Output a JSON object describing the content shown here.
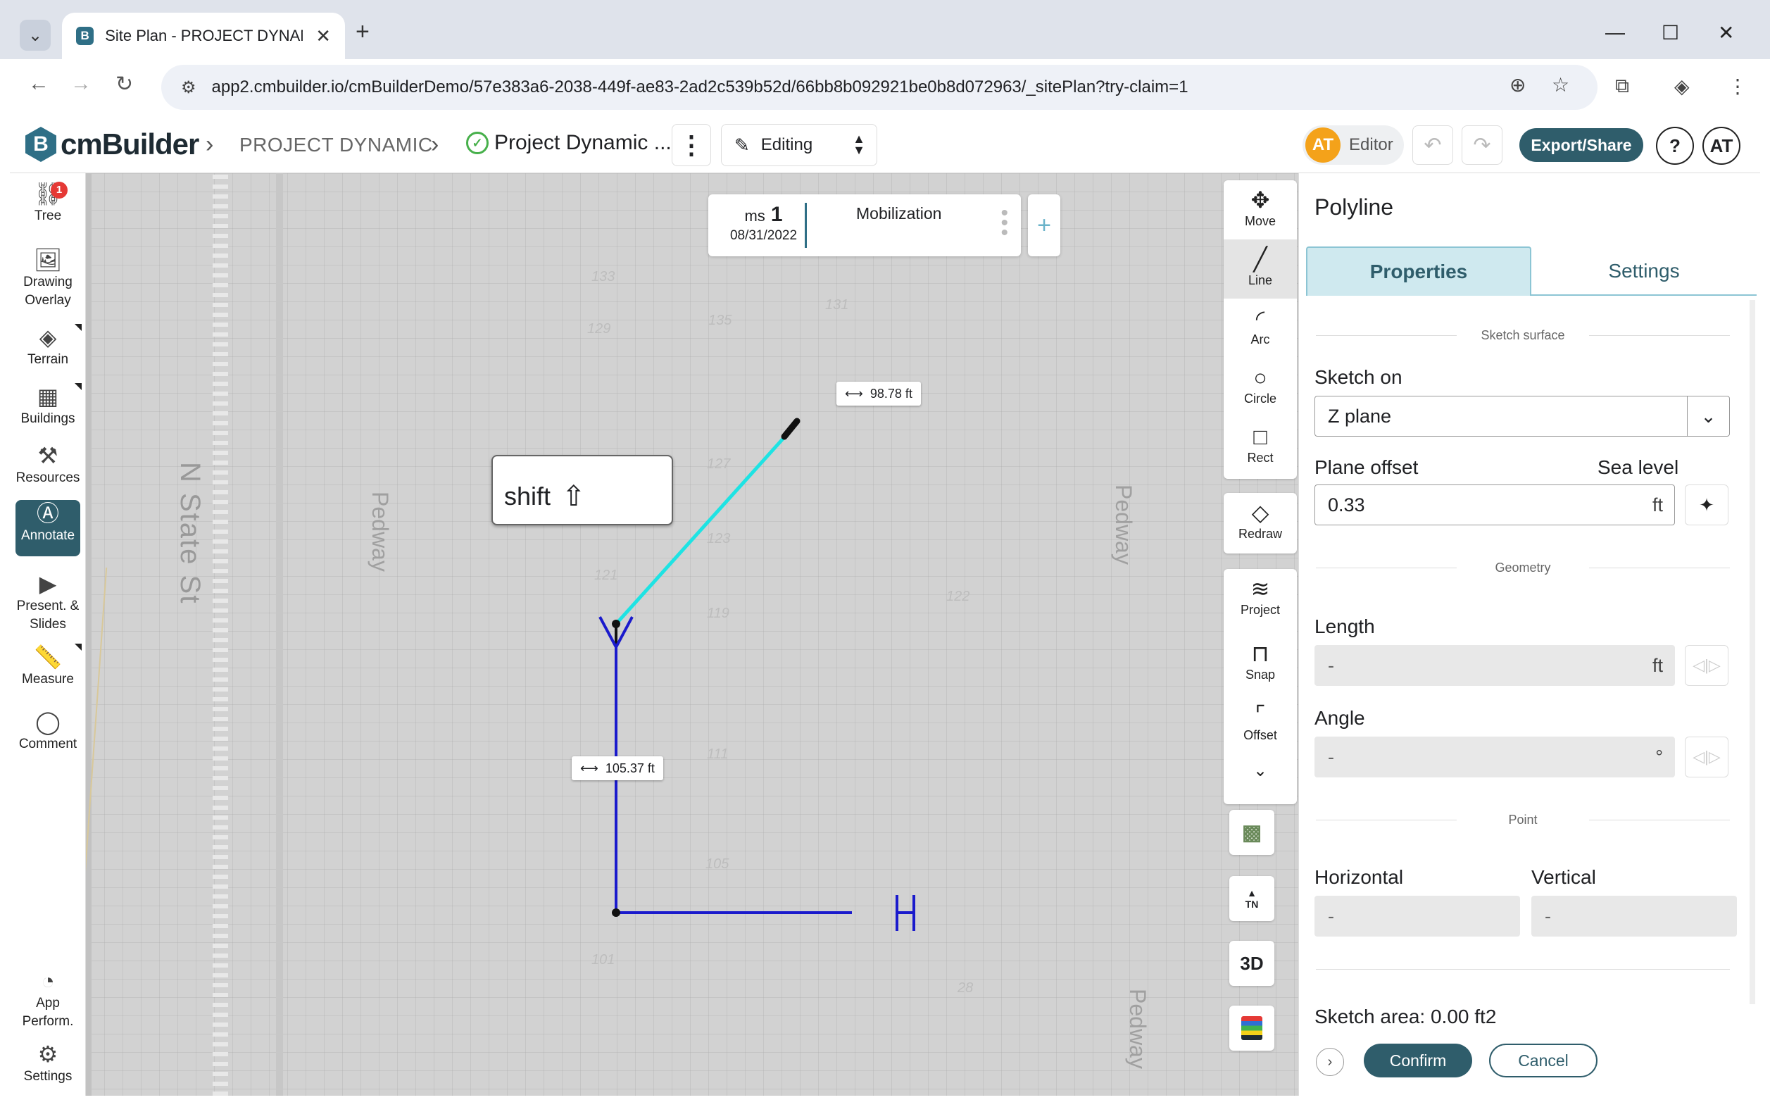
{
  "browser": {
    "tab_title": "Site Plan - PROJECT DYNAMIC |",
    "tab_favicon": "B",
    "url": "app2.cmbuilder.io/cmBuilderDemo/57e383a6-2038-449f-ae83-2ad2c539b52d/66bb8b092921be0b8d072963/_sitePlan?try-claim=1",
    "new_tab": "+",
    "tab_close": "✕"
  },
  "header": {
    "logo_mark": "B",
    "logo_text": "cmBuilder",
    "breadcrumb_project": "PROJECT DYNAMIC",
    "breadcrumb_plan": "Project Dynamic ...",
    "mode_label": "Editing",
    "editor_initials": "AT",
    "editor_label": "Editor",
    "export_label": "Export/Share",
    "help_label": "?",
    "user_initials": "AT"
  },
  "sidebar": {
    "items": [
      {
        "label": "Tree",
        "icon": "tree-icon",
        "badge": "1"
      },
      {
        "label": "Drawing Overlay",
        "icon": "image-icon"
      },
      {
        "label": "Terrain",
        "icon": "terrain-icon"
      },
      {
        "label": "Buildings",
        "icon": "buildings-icon"
      },
      {
        "label": "Resources",
        "icon": "resources-icon"
      },
      {
        "label": "Annotate",
        "icon": "annotate-icon",
        "active": true
      },
      {
        "label": "Present. & Slides",
        "icon": "presentation-icon"
      },
      {
        "label": "Measure",
        "icon": "ruler-icon"
      },
      {
        "label": "Comment",
        "icon": "comment-icon"
      }
    ],
    "bottom": [
      {
        "label": "App Perform.",
        "icon": "gauge-icon"
      },
      {
        "label": "Settings",
        "icon": "gear-icon"
      }
    ]
  },
  "canvas": {
    "milestone": {
      "label": "ms",
      "number": "1",
      "date": "08/31/2022",
      "title": "Mobilization"
    },
    "street_label": "N State St",
    "pedway_labels": [
      "Pedway",
      "Pedway",
      "Pedway"
    ],
    "lot_numbers": [
      "133",
      "129",
      "135",
      "131",
      "127",
      "123",
      "121",
      "119",
      "122",
      "111",
      "105",
      "101",
      "28"
    ],
    "dim_upper": "98.78  ft",
    "dim_lower": "105.37  ft",
    "key_hint": "shift"
  },
  "tools": {
    "draw": [
      {
        "label": "Move",
        "icon": "move-icon"
      },
      {
        "label": "Line",
        "icon": "line-icon",
        "selected": true
      },
      {
        "label": "Arc",
        "icon": "arc-icon"
      },
      {
        "label": "Circle",
        "icon": "circle-icon"
      },
      {
        "label": "Rect",
        "icon": "rect-icon"
      }
    ],
    "redraw": "Redraw",
    "modify": [
      {
        "label": "Project",
        "icon": "project-icon"
      },
      {
        "label": "Snap",
        "icon": "snap-icon"
      },
      {
        "label": "Offset",
        "icon": "offset-icon"
      }
    ],
    "north_label": "TN",
    "view_3d": "3D"
  },
  "panel": {
    "title": "Polyline",
    "tab_properties": "Properties",
    "tab_settings": "Settings",
    "section_surface": "Sketch surface",
    "sketch_on_label": "Sketch on",
    "sketch_on_value": "Z plane",
    "plane_offset_label": "Plane offset",
    "sea_level_label": "Sea level",
    "plane_offset_value": "0.33",
    "unit_ft": "ft",
    "section_geometry": "Geometry",
    "length_label": "Length",
    "length_value": "-",
    "angle_label": "Angle",
    "angle_value": "-",
    "angle_unit": "°",
    "section_point": "Point",
    "horizontal_label": "Horizontal",
    "horizontal_value": "-",
    "vertical_label": "Vertical",
    "vertical_value": "-",
    "sketch_area": "Sketch area: 0.00 ft2",
    "confirm_label": "Confirm",
    "cancel_label": "Cancel"
  },
  "colors": {
    "brand": "#2f5d6b",
    "accent_light": "#cfe9ef",
    "line_active": "#1ee3e3",
    "line_drawn": "#1a1acc",
    "avatar": "#f4a21a",
    "badge": "#e53935"
  }
}
